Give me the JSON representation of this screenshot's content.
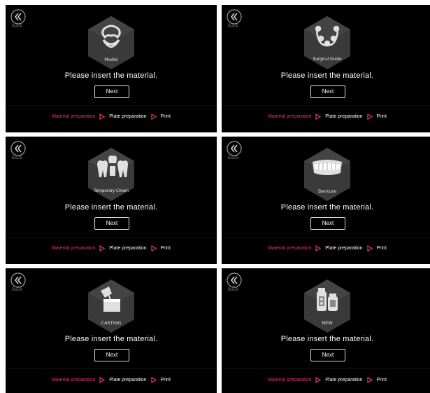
{
  "colors": {
    "background": "#000000",
    "accent": "#e8336e",
    "text": "#ffffff",
    "muted": "#7a7a7a",
    "hexagon": "#3a3a3a"
  },
  "common": {
    "back_label": "Back",
    "prompt": "Please insert the material.",
    "next_label": "Next",
    "steps": [
      "Material preparation",
      "Plate preparation",
      "Print"
    ],
    "active_step": 0
  },
  "panels": [
    {
      "material_label": "Model",
      "icon": "model-icon"
    },
    {
      "material_label": "Surgical Guide",
      "icon": "surgical-guide-icon"
    },
    {
      "material_label": "Temporary Crown",
      "icon": "temporary-crown-icon"
    },
    {
      "material_label": "Denture",
      "icon": "denture-icon"
    },
    {
      "material_label": "CASTING",
      "icon": "casting-icon"
    },
    {
      "material_label": "NEW",
      "icon": "new-material-icon"
    }
  ]
}
